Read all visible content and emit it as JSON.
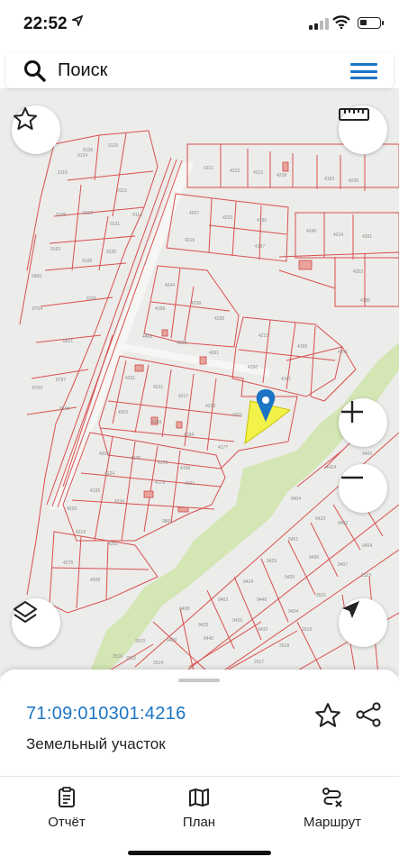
{
  "status_bar": {
    "time": "22:52"
  },
  "search": {
    "placeholder": "Поиск"
  },
  "map": {
    "colors": {
      "water": "#d6e8b8",
      "parcel_line": "#d8504f",
      "selected": "#f2f24a",
      "pin": "#1b74c4"
    }
  },
  "selection": {
    "cadastral_number": "71:09:010301:4216",
    "type": "Земельный участок"
  },
  "tabs": [
    {
      "label": "Отчёт",
      "icon": "report-icon"
    },
    {
      "label": "План",
      "icon": "map-icon"
    },
    {
      "label": "Маршрут",
      "icon": "route-icon"
    }
  ],
  "icons": [
    "search-icon",
    "menu-icon",
    "star-icon",
    "ruler-icon",
    "zoom-in-icon",
    "zoom-out-icon",
    "layers-icon",
    "navigate-icon",
    "share-icon",
    "location-pin-icon"
  ]
}
